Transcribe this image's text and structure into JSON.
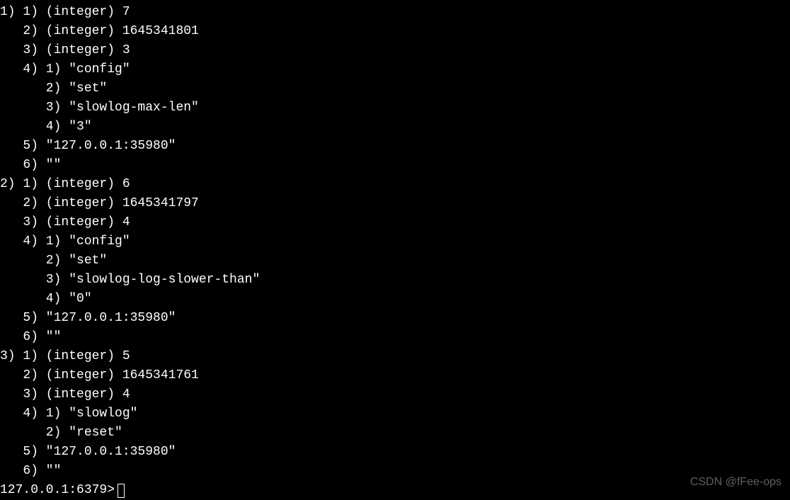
{
  "output": {
    "entries": [
      {
        "outer_index": "1)",
        "fields": [
          {
            "idx": "1)",
            "type": "integer",
            "value": "7"
          },
          {
            "idx": "2)",
            "type": "integer",
            "value": "1645341801"
          },
          {
            "idx": "3)",
            "type": "integer",
            "value": "3"
          },
          {
            "idx": "4)",
            "type": "array",
            "items": [
              {
                "idx": "1)",
                "value": "\"config\""
              },
              {
                "idx": "2)",
                "value": "\"set\""
              },
              {
                "idx": "3)",
                "value": "\"slowlog-max-len\""
              },
              {
                "idx": "4)",
                "value": "\"3\""
              }
            ]
          },
          {
            "idx": "5)",
            "type": "string",
            "value": "\"127.0.0.1:35980\""
          },
          {
            "idx": "6)",
            "type": "string",
            "value": "\"\""
          }
        ]
      },
      {
        "outer_index": "2)",
        "fields": [
          {
            "idx": "1)",
            "type": "integer",
            "value": "6"
          },
          {
            "idx": "2)",
            "type": "integer",
            "value": "1645341797"
          },
          {
            "idx": "3)",
            "type": "integer",
            "value": "4"
          },
          {
            "idx": "4)",
            "type": "array",
            "items": [
              {
                "idx": "1)",
                "value": "\"config\""
              },
              {
                "idx": "2)",
                "value": "\"set\""
              },
              {
                "idx": "3)",
                "value": "\"slowlog-log-slower-than\""
              },
              {
                "idx": "4)",
                "value": "\"0\""
              }
            ]
          },
          {
            "idx": "5)",
            "type": "string",
            "value": "\"127.0.0.1:35980\""
          },
          {
            "idx": "6)",
            "type": "string",
            "value": "\"\""
          }
        ]
      },
      {
        "outer_index": "3)",
        "fields": [
          {
            "idx": "1)",
            "type": "integer",
            "value": "5"
          },
          {
            "idx": "2)",
            "type": "integer",
            "value": "1645341761"
          },
          {
            "idx": "3)",
            "type": "integer",
            "value": "4"
          },
          {
            "idx": "4)",
            "type": "array",
            "items": [
              {
                "idx": "1)",
                "value": "\"slowlog\""
              },
              {
                "idx": "2)",
                "value": "\"reset\""
              }
            ]
          },
          {
            "idx": "5)",
            "type": "string",
            "value": "\"127.0.0.1:35980\""
          },
          {
            "idx": "6)",
            "type": "string",
            "value": "\"\""
          }
        ]
      }
    ]
  },
  "prompt": "127.0.0.1:6379> ",
  "watermark": "CSDN @fFee-ops"
}
